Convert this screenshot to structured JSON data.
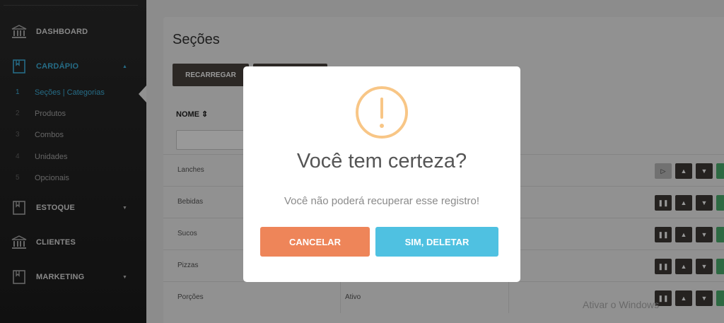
{
  "sidebar": {
    "menu": [
      {
        "label": "DASHBOARD",
        "icon": "bank-icon"
      },
      {
        "label": "CARDÁPIO",
        "icon": "book-icon",
        "caret": "▲"
      },
      {
        "label": "ESTOQUE",
        "icon": "book-icon",
        "caret": "▼"
      },
      {
        "label": "CLIENTES",
        "icon": "bank-icon"
      },
      {
        "label": "MARKETING",
        "icon": "book-icon",
        "caret": "▼"
      }
    ],
    "submenu": [
      {
        "num": "1",
        "label": "Seções | Categorias"
      },
      {
        "num": "2",
        "label": "Produtos"
      },
      {
        "num": "3",
        "label": "Combos"
      },
      {
        "num": "4",
        "label": "Unidades"
      },
      {
        "num": "5",
        "label": "Opcionais"
      }
    ]
  },
  "main": {
    "title": "Seções",
    "reload_label": "RECARREGAR",
    "column_name": "NOME ⇕",
    "rows": [
      {
        "name": "Lanches",
        "status": ""
      },
      {
        "name": "Bebidas",
        "status": ""
      },
      {
        "name": "Sucos",
        "status": ""
      },
      {
        "name": "Pizzas",
        "status": ""
      },
      {
        "name": "Porções",
        "status": "Ativo"
      }
    ]
  },
  "watermark": "Ativar o Windows",
  "modal": {
    "title": "Você tem certeza?",
    "text": "Você não poderá recuperar esse registro!",
    "cancel_label": "CANCELAR",
    "confirm_label": "SIM, DELETAR"
  },
  "colors": {
    "accent": "#3fb4e0",
    "warning": "#f8c686",
    "cancel": "#ee8559",
    "confirm": "#4fc1e1"
  }
}
